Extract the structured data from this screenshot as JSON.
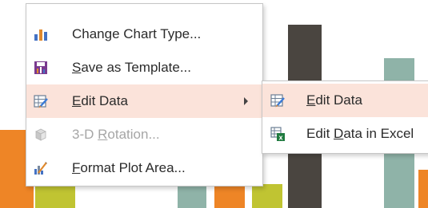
{
  "context_menu": {
    "items": [
      {
        "label": "Change Chart Type...",
        "icon": "bar-chart-icon",
        "enabled": true
      },
      {
        "pre": "",
        "u": "S",
        "post": "ave as Template...",
        "icon": "save-template-icon",
        "enabled": true
      },
      {
        "pre": "",
        "u": "E",
        "post": "dit Data",
        "icon": "edit-data-icon",
        "enabled": true,
        "highlighted": true,
        "has_submenu": true
      },
      {
        "pre": "3-D ",
        "u": "R",
        "post": "otation...",
        "icon": "rotation-3d-icon",
        "enabled": false
      },
      {
        "pre": "",
        "u": "F",
        "post": "ormat Plot Area...",
        "icon": "format-plot-area-icon",
        "enabled": true
      }
    ]
  },
  "submenu": {
    "items": [
      {
        "pre": "",
        "u": "E",
        "post": "dit Data",
        "icon": "edit-data-icon",
        "highlighted": true
      },
      {
        "pre": "Edit ",
        "u": "D",
        "post": "ata in Excel",
        "icon": "excel-edit-icon",
        "highlighted": false
      }
    ]
  },
  "chart_colors": {
    "orange": "#ee8526",
    "olive": "#c0c432",
    "dark": "#4a4540",
    "sage": "#8fb3a8"
  }
}
